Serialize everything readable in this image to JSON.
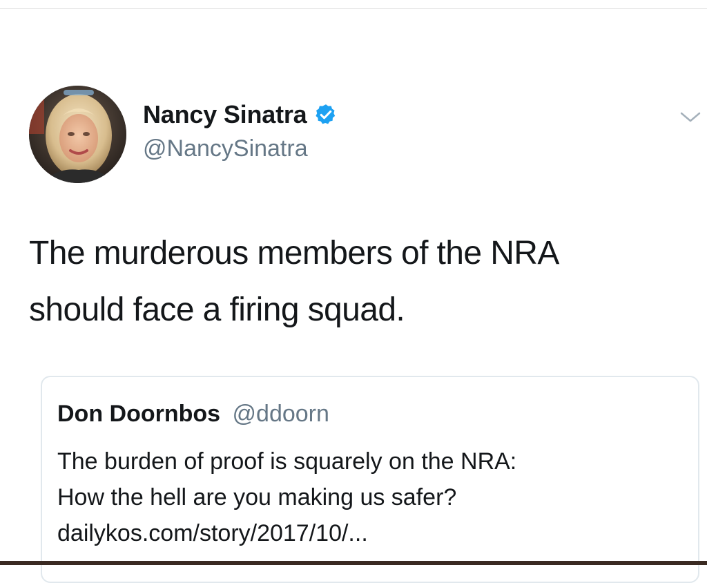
{
  "tweet": {
    "author": {
      "display_name": "Nancy Sinatra",
      "handle": "@NancySinatra",
      "verified": true,
      "avatar": "profile-photo"
    },
    "text_lines": [
      "The murderous members of the NRA",
      "should face a firing squad."
    ],
    "caret_icon": "chevron-down-icon",
    "verified_color": "#1da1f2",
    "quote": {
      "display_name": "Don Doornbos",
      "handle": "@ddoorn",
      "text_lines": [
        "The burden of proof is squarely on the NRA:",
        "How the hell are you making us safer?",
        "dailykos.com/story/2017/10/..."
      ]
    }
  }
}
